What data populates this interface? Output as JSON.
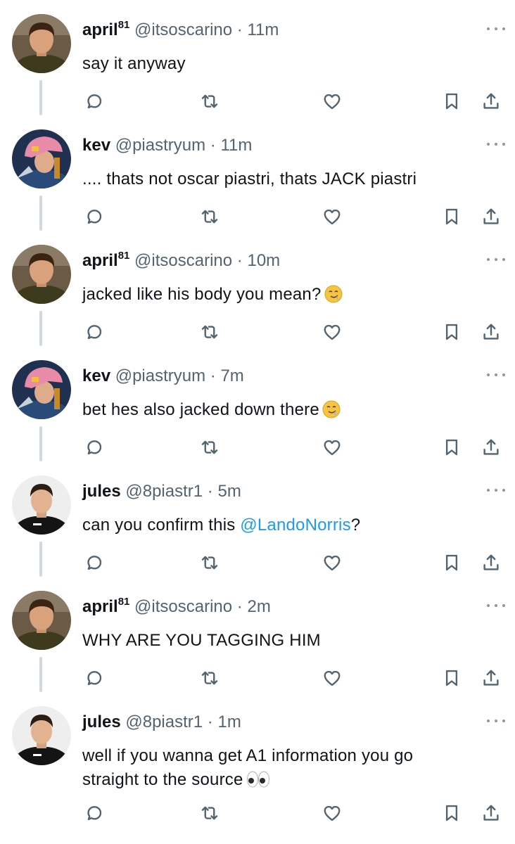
{
  "thread": [
    {
      "name": "april",
      "sup": "81",
      "handle": "@itsoscarino",
      "sep": "·",
      "time": "11m",
      "text": "say it anyway",
      "mention": "",
      "after": "",
      "text2": "",
      "emoji": "",
      "avatar": "avatar-april"
    },
    {
      "name": "kev",
      "sup": "",
      "handle": "@piastryum",
      "sep": "·",
      "time": "11m",
      "text": ".... thats not oscar piastri, thats JACK piastri",
      "mention": "",
      "after": "",
      "text2": "",
      "emoji": "",
      "avatar": "avatar-kev"
    },
    {
      "name": "april",
      "sup": "81",
      "handle": "@itsoscarino",
      "sep": "·",
      "time": "10m",
      "text": "jacked like his body you mean?",
      "mention": "",
      "after": "",
      "text2": "",
      "emoji": "smirk-emoji",
      "avatar": "avatar-april"
    },
    {
      "name": "kev",
      "sup": "",
      "handle": "@piastryum",
      "sep": "·",
      "time": "7m",
      "text": "bet hes also jacked down there",
      "mention": "",
      "after": "",
      "text2": "",
      "emoji": "smirk-emoji",
      "avatar": "avatar-kev"
    },
    {
      "name": "jules",
      "sup": "",
      "handle": "@8piastr1",
      "sep": "·",
      "time": "5m",
      "text": "can you confirm this ",
      "mention": "@LandoNorris",
      "after": "?",
      "text2": "",
      "emoji": "",
      "avatar": "avatar-jules"
    },
    {
      "name": "april",
      "sup": "81",
      "handle": "@itsoscarino",
      "sep": "·",
      "time": "2m",
      "text": "WHY ARE YOU TAGGING HIM",
      "mention": "",
      "after": "",
      "text2": "",
      "emoji": "",
      "avatar": "avatar-april"
    },
    {
      "name": "jules",
      "sup": "",
      "handle": "@8piastr1",
      "sep": "·",
      "time": "1m",
      "text": "well if you wanna get A1 information you go",
      "mention": "",
      "after": "",
      "text2": "straight to the source",
      "emoji": "eyes-emoji",
      "avatar": "avatar-jules"
    }
  ],
  "actions": [
    "reply-icon",
    "retweet-icon",
    "like-icon",
    "bookmark-icon",
    "share-icon"
  ],
  "icons": {
    "more": "more-dots-icon"
  },
  "colors": {
    "text": "#0f1419",
    "muted": "#536471",
    "link": "#1d9bf0",
    "icon": "#536471",
    "thread_line": "#cfd9de"
  }
}
